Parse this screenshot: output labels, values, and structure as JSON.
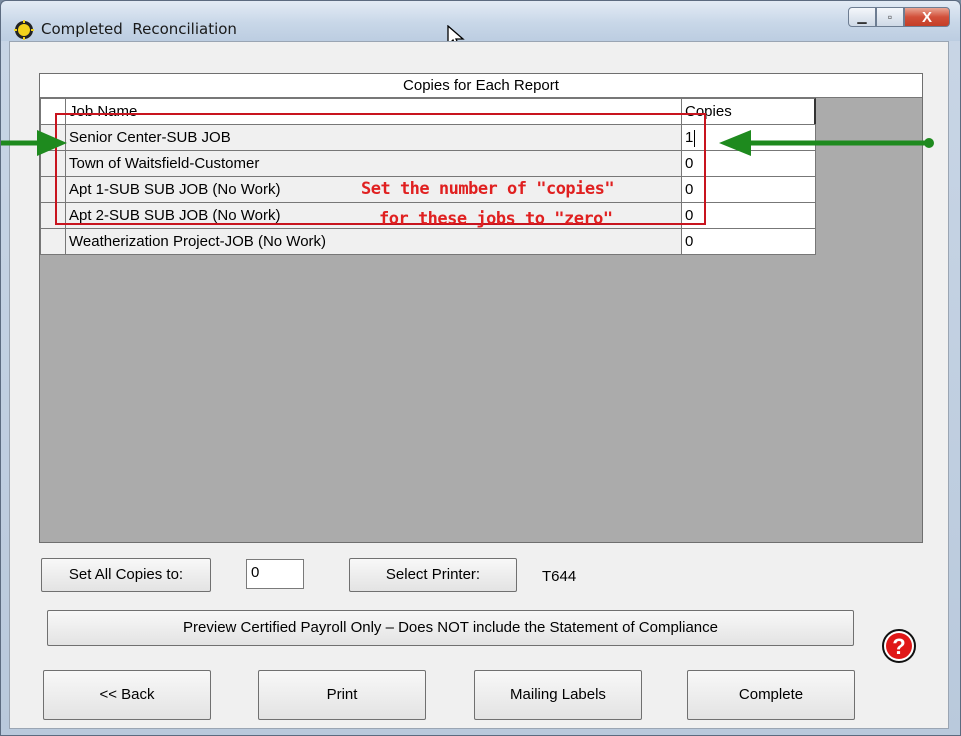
{
  "window": {
    "title": "Completed  Reconciliation",
    "minimize_symbol": "▁",
    "maximize_symbol": "▫",
    "close_symbol": "X"
  },
  "grid": {
    "caption": "Copies for Each Report",
    "columns": [
      "Job Name",
      "Copies"
    ],
    "rows": [
      {
        "job_name": "Senior Center-SUB JOB",
        "copies": "1"
      },
      {
        "job_name": "Town of Waitsfield-Customer",
        "copies": "0"
      },
      {
        "job_name": "Apt 1-SUB SUB JOB (No Work)",
        "copies": "0"
      },
      {
        "job_name": "Apt 2-SUB SUB JOB (No Work)",
        "copies": "0"
      },
      {
        "job_name": "Weatherization Project-JOB (No Work)",
        "copies": "0"
      }
    ]
  },
  "annotation": {
    "line1": "Set the number of \"copies\"",
    "line2": "for these jobs to \"zero\"",
    "arrow_color": "#1e8a1e",
    "box_color": "#c8141e"
  },
  "controls": {
    "set_all_label": "Set All Copies to:",
    "set_all_value": "0",
    "select_printer_label": "Select Printer:",
    "printer_name": "T644",
    "preview_label": "Preview Certified Payroll Only – Does NOT include the Statement of Compliance",
    "back_label": "<< Back",
    "print_label": "Print",
    "mailing_labels_label": "Mailing Labels",
    "complete_label": "Complete",
    "help_symbol": "?"
  },
  "icons": [
    "sun-app-icon",
    "mouse-cursor-icon",
    "help-icon",
    "arrow-right-icon",
    "arrow-left-icon"
  ]
}
